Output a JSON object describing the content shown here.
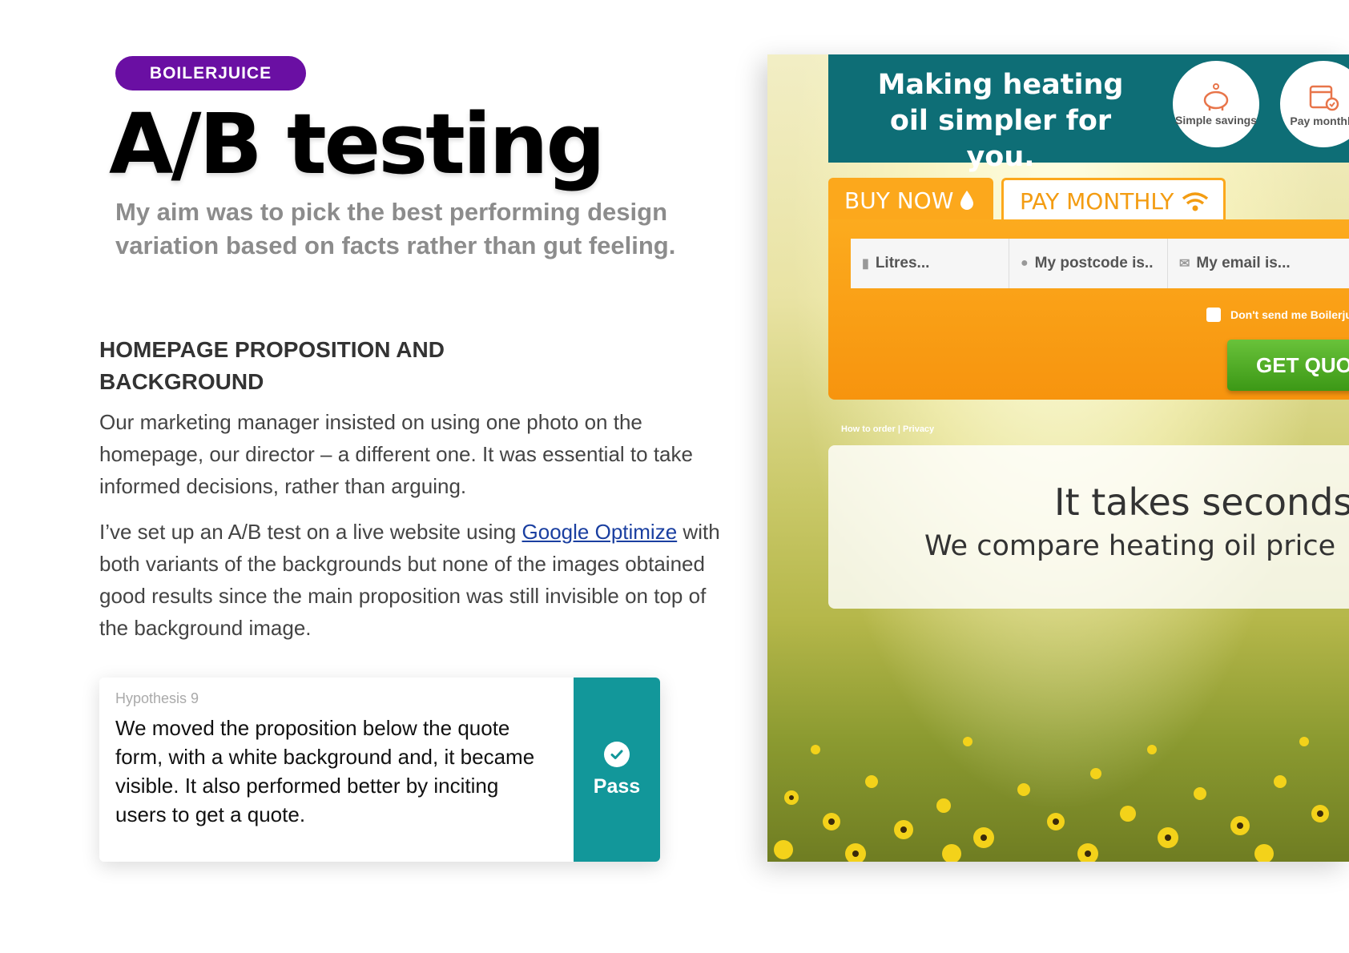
{
  "left": {
    "tag": "BOILERJUICE",
    "title": "A/B testing",
    "lede": "My aim was to pick the best performing design variation based on facts rather than gut feeling.",
    "section_title": "HOMEPAGE PROPOSITION AND BACKGROUND",
    "para1": "Our marketing manager insisted on using one photo on the homepage, our director – a different one. It was essential to take informed decisions, rather than arguing.",
    "para2_before": "I’ve set up an A/B test on a live website using ",
    "para2_link": "Google Optimize",
    "para2_after": " with both variants of the backgrounds but none of the images obtained good results since the main proposition was still invisible on top of the background image.",
    "hypothesis": {
      "label": "Hypothesis 9",
      "text": "We moved the proposition below the quote form, with a white background and, it became visible. It also performed better by inciting users to get a quote.",
      "result": "Pass",
      "result_icon": "check-circle-icon",
      "result_color": "#12979a"
    }
  },
  "screenshot": {
    "banner_text": "Making heating oil simpler for you.",
    "banner_color": "#0e6e76",
    "badges": [
      {
        "label": "Simple savings",
        "icon": "piggy-bank-icon"
      },
      {
        "label": "Pay monthly",
        "icon": "calendar-check-icon"
      }
    ],
    "tabs": {
      "buy_now": "BUY NOW",
      "pay_monthly": "PAY MONTHLY"
    },
    "fields": {
      "litres": "Litres...",
      "postcode": "My postcode is..",
      "email": "My email is..."
    },
    "optout": "Don't send me Boilerju",
    "how_to_order": "How to order | Privacy",
    "get_quote": "GET QUO",
    "proposition_title": "It takes seconds",
    "proposition_sub": "We compare heating oil price",
    "accent_orange": "#fca81c",
    "accent_green": "#3c9816"
  }
}
